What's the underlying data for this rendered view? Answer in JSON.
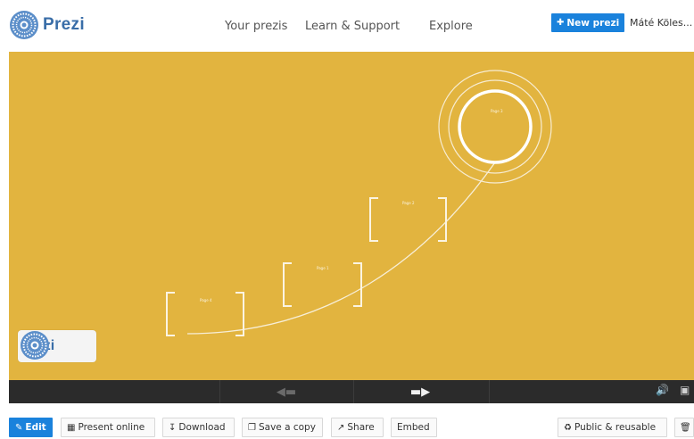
{
  "header": {
    "brand": "Prezi",
    "nav": [
      "Your prezis",
      "Learn & Support",
      "Explore"
    ],
    "new_prezi_label": "New prezi",
    "new_prezi_icon": "plus-document-icon",
    "user_name": "Máté Köles..."
  },
  "canvas": {
    "background_color": "#e2b43f",
    "frame_labels": [
      "Page 4",
      "Page 1",
      "Page 2",
      "Page 3"
    ],
    "watermark": "Prezi"
  },
  "player": {
    "prev_icon": "left-arrow-icon",
    "next_icon": "right-arrow-icon",
    "volume_icon": "volume-icon",
    "fullscreen_icon": "fullscreen-icon"
  },
  "toolbar": {
    "edit": "Edit",
    "present_online": "Present online",
    "download": "Download",
    "save_copy": "Save a copy",
    "share": "Share",
    "embed": "Embed",
    "public_reusable": "Public & reusable"
  },
  "colors": {
    "accent": "#1a82dc",
    "brand_text": "#3a6ea8",
    "player_bar": "#2b2b2b"
  }
}
